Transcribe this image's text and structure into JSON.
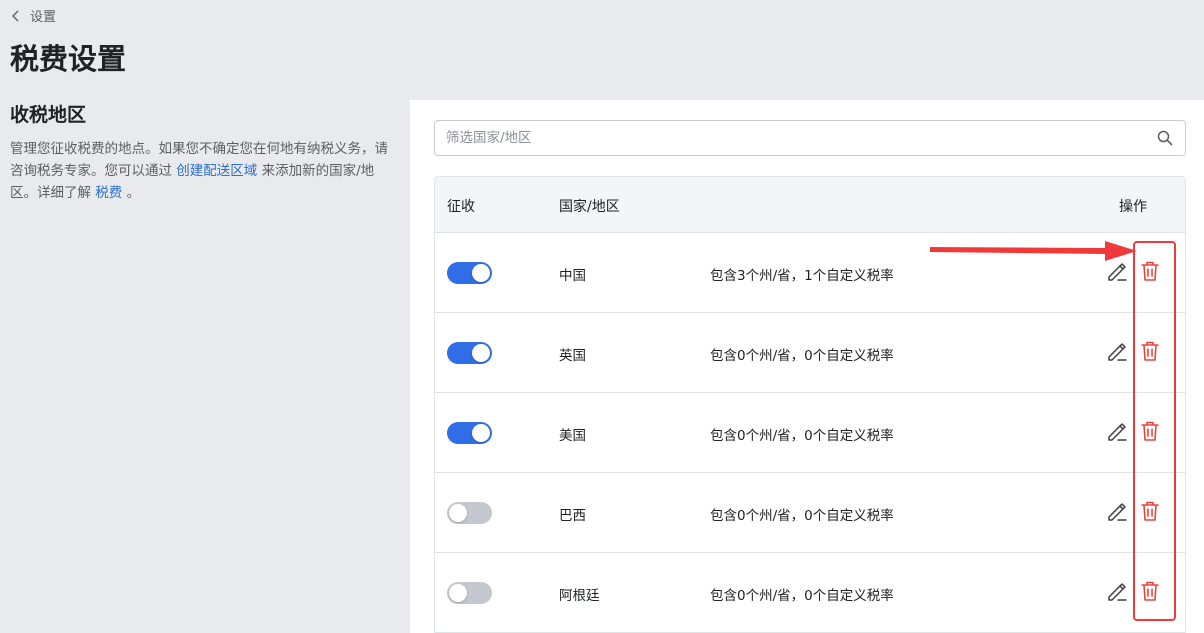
{
  "breadcrumb": {
    "label": "设置"
  },
  "page": {
    "title": "税费设置"
  },
  "section": {
    "title": "收税地区",
    "desc_prefix": "管理您征收税费的地点。如果您不确定您在何地有纳税义务，请咨询税务专家。您可以通过 ",
    "link1": "创建配送区域",
    "desc_middle": " 来添加新的国家/地区。详细了解 ",
    "link2": "税费",
    "desc_suffix": " 。"
  },
  "search": {
    "placeholder": "筛选国家/地区",
    "value": ""
  },
  "table": {
    "headers": {
      "collect": "征收",
      "country": "国家/地区",
      "actions": "操作"
    },
    "rows": [
      {
        "enabled": true,
        "country": "中国",
        "desc": "包含3个州/省，1个自定义税率"
      },
      {
        "enabled": true,
        "country": "英国",
        "desc": "包含0个州/省，0个自定义税率"
      },
      {
        "enabled": true,
        "country": "美国",
        "desc": "包含0个州/省，0个自定义税率"
      },
      {
        "enabled": false,
        "country": "巴西",
        "desc": "包含0个州/省，0个自定义税率"
      },
      {
        "enabled": false,
        "country": "阿根廷",
        "desc": "包含0个州/省，0个自定义税率"
      }
    ]
  },
  "icons": {
    "back": "chevron-left-icon",
    "search": "search-icon",
    "edit": "pencil-icon",
    "delete": "trash-icon"
  },
  "colors": {
    "toggle_on": "#2f6ee6",
    "toggle_off": "#c4c8cf",
    "delete": "#e8453c",
    "link": "#2c6ecb",
    "annotation": "#f03a3a"
  }
}
